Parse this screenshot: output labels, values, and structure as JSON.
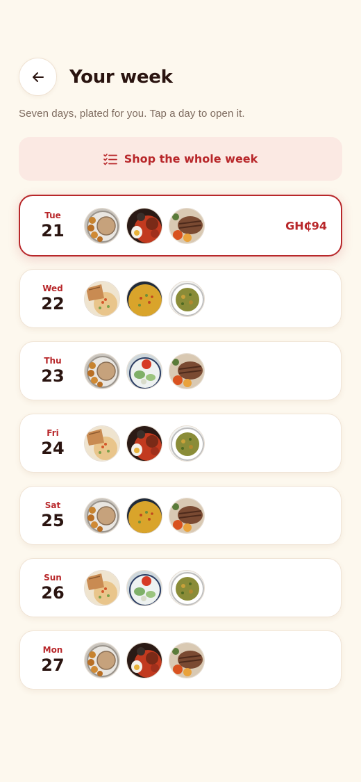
{
  "header": {
    "title": "Your week",
    "back_icon": "arrow-left-icon"
  },
  "subtitle": "Seven days, plated for you. Tap a day to open it.",
  "shop_button": {
    "label": "Shop the whole week",
    "icon": "checklist-icon"
  },
  "colors": {
    "accent": "#b8272a",
    "background": "#fdf8ee",
    "shop_bg": "#fbe9e3"
  },
  "days": [
    {
      "dow": "Tue",
      "num": "21",
      "price": "GH₵94",
      "selected": true,
      "meals": [
        "groundnut-soup-balls",
        "jollof-rice-egg",
        "grilled-chicken-plate"
      ]
    },
    {
      "dow": "Wed",
      "num": "22",
      "price": "",
      "selected": false,
      "meals": [
        "fried-rice-chicken",
        "yellow-rice",
        "green-stew-rice"
      ]
    },
    {
      "dow": "Thu",
      "num": "23",
      "price": "",
      "selected": false,
      "meals": [
        "groundnut-soup-balls",
        "salad-plate",
        "grilled-chicken-plate"
      ]
    },
    {
      "dow": "Fri",
      "num": "24",
      "price": "",
      "selected": false,
      "meals": [
        "fried-rice-chicken",
        "jollof-rice-egg",
        "green-stew-rice"
      ]
    },
    {
      "dow": "Sat",
      "num": "25",
      "price": "",
      "selected": false,
      "meals": [
        "groundnut-soup-balls",
        "yellow-rice",
        "grilled-chicken-plate"
      ]
    },
    {
      "dow": "Sun",
      "num": "26",
      "price": "",
      "selected": false,
      "meals": [
        "fried-rice-chicken",
        "salad-plate",
        "green-stew-rice"
      ]
    },
    {
      "dow": "Mon",
      "num": "27",
      "price": "",
      "selected": false,
      "meals": [
        "groundnut-soup-balls",
        "jollof-rice-egg",
        "grilled-chicken-plate"
      ]
    }
  ]
}
